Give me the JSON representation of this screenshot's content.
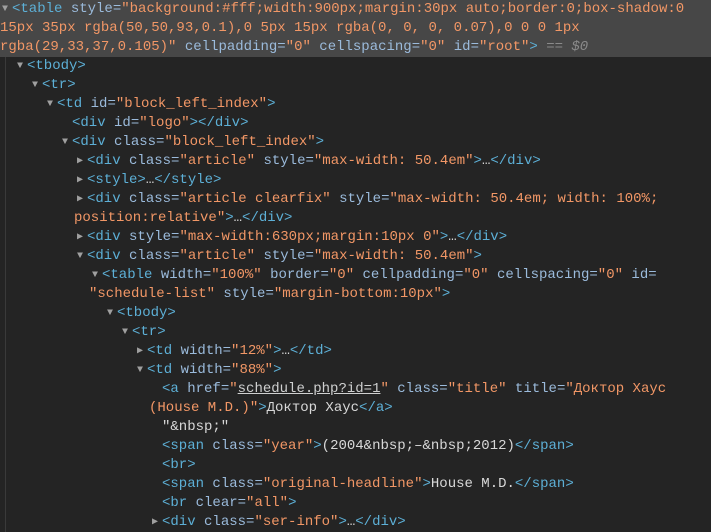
{
  "panel": "Elements",
  "nodes": [
    {
      "level": 0,
      "arrow": "open",
      "selected": true,
      "segs": [
        [
          "t",
          "<table"
        ],
        [
          "n",
          " style"
        ],
        [
          "e",
          "="
        ],
        [
          "v",
          "\"background:#fff;width:900px;margin:30px auto;border:0;box-shadow:0 15px 35px rgba(50,50,93,0.1),0 5px 15px rgba(0, 0, 0, 0.07),0 0 0 1px rgba(29,33,37,0.105)\""
        ],
        [
          "n",
          " cellpadding"
        ],
        [
          "e",
          "="
        ],
        [
          "v",
          "\"0\""
        ],
        [
          "n",
          " cellspacing"
        ],
        [
          "e",
          "="
        ],
        [
          "v",
          "\"0\""
        ],
        [
          "n",
          " id"
        ],
        [
          "e",
          "="
        ],
        [
          "v",
          "\"root\""
        ],
        [
          "t",
          ">"
        ],
        [
          "d",
          " == $0"
        ]
      ]
    },
    {
      "level": 1,
      "arrow": "open",
      "segs": [
        [
          "t",
          "<tbody>"
        ]
      ]
    },
    {
      "level": 2,
      "arrow": "open",
      "segs": [
        [
          "t",
          "<tr>"
        ]
      ]
    },
    {
      "level": 3,
      "arrow": "open",
      "segs": [
        [
          "t",
          "<td"
        ],
        [
          "n",
          " id"
        ],
        [
          "e",
          "="
        ],
        [
          "v",
          "\"block_left_index\""
        ],
        [
          "t",
          ">"
        ]
      ]
    },
    {
      "level": 4,
      "arrow": null,
      "segs": [
        [
          "t",
          "<div"
        ],
        [
          "n",
          " id"
        ],
        [
          "e",
          "="
        ],
        [
          "v",
          "\"logo\""
        ],
        [
          "t",
          "></div>"
        ]
      ]
    },
    {
      "level": 4,
      "arrow": "open",
      "segs": [
        [
          "t",
          "<div"
        ],
        [
          "n",
          " class"
        ],
        [
          "e",
          "="
        ],
        [
          "v",
          "\"block_left_index\""
        ],
        [
          "t",
          ">"
        ]
      ]
    },
    {
      "level": 5,
      "arrow": "closed",
      "segs": [
        [
          "t",
          "<div"
        ],
        [
          "n",
          " class"
        ],
        [
          "e",
          "="
        ],
        [
          "v",
          "\"article\""
        ],
        [
          "n",
          " style"
        ],
        [
          "e",
          "="
        ],
        [
          "v",
          "\"max-width: 50.4em\""
        ],
        [
          "t",
          ">"
        ],
        [
          "x",
          "…"
        ],
        [
          "t",
          "</div>"
        ]
      ]
    },
    {
      "level": 5,
      "arrow": "closed",
      "segs": [
        [
          "t",
          "<style>"
        ],
        [
          "x",
          "…"
        ],
        [
          "t",
          "</style>"
        ]
      ]
    },
    {
      "level": 5,
      "arrow": "closed",
      "segs": [
        [
          "t",
          "<div"
        ],
        [
          "n",
          " class"
        ],
        [
          "e",
          "="
        ],
        [
          "v",
          "\"article clearfix\""
        ],
        [
          "n",
          " style"
        ],
        [
          "e",
          "="
        ],
        [
          "v",
          "\"max-width: 50.4em; width: 100%; position:relative\""
        ],
        [
          "t",
          ">"
        ],
        [
          "x",
          "…"
        ],
        [
          "t",
          "</div>"
        ]
      ]
    },
    {
      "level": 5,
      "arrow": "closed",
      "segs": [
        [
          "t",
          "<div"
        ],
        [
          "n",
          " style"
        ],
        [
          "e",
          "="
        ],
        [
          "v",
          "\"max-width:630px;margin:10px 0\""
        ],
        [
          "t",
          ">"
        ],
        [
          "x",
          "…"
        ],
        [
          "t",
          "</div>"
        ]
      ]
    },
    {
      "level": 5,
      "arrow": "open",
      "segs": [
        [
          "t",
          "<div"
        ],
        [
          "n",
          " class"
        ],
        [
          "e",
          "="
        ],
        [
          "v",
          "\"article\""
        ],
        [
          "n",
          " style"
        ],
        [
          "e",
          "="
        ],
        [
          "v",
          "\"max-width: 50.4em\""
        ],
        [
          "t",
          ">"
        ]
      ]
    },
    {
      "level": 6,
      "arrow": "open",
      "segs": [
        [
          "t",
          "<table"
        ],
        [
          "n",
          " width"
        ],
        [
          "e",
          "="
        ],
        [
          "v",
          "\"100%\""
        ],
        [
          "n",
          " border"
        ],
        [
          "e",
          "="
        ],
        [
          "v",
          "\"0\""
        ],
        [
          "n",
          " cellpadding"
        ],
        [
          "e",
          "="
        ],
        [
          "v",
          "\"0\""
        ],
        [
          "n",
          " cellspacing"
        ],
        [
          "e",
          "="
        ],
        [
          "v",
          "\"0\""
        ],
        [
          "n",
          " id="
        ],
        [
          "v",
          " \"schedule-list\""
        ],
        [
          "n",
          " style"
        ],
        [
          "e",
          "="
        ],
        [
          "v",
          "\"margin-bottom:10px\""
        ],
        [
          "t",
          ">"
        ]
      ]
    },
    {
      "level": 7,
      "arrow": "open",
      "segs": [
        [
          "t",
          "<tbody>"
        ]
      ]
    },
    {
      "level": 8,
      "arrow": "open",
      "segs": [
        [
          "t",
          "<tr>"
        ]
      ]
    },
    {
      "level": 9,
      "arrow": "closed",
      "segs": [
        [
          "t",
          "<td"
        ],
        [
          "n",
          " width"
        ],
        [
          "e",
          "="
        ],
        [
          "v",
          "\"12%\""
        ],
        [
          "t",
          ">"
        ],
        [
          "x",
          "…"
        ],
        [
          "t",
          "</td>"
        ]
      ]
    },
    {
      "level": 9,
      "arrow": "open",
      "segs": [
        [
          "t",
          "<td"
        ],
        [
          "n",
          " width"
        ],
        [
          "e",
          "="
        ],
        [
          "v",
          "\"88%\""
        ],
        [
          "t",
          ">"
        ]
      ]
    },
    {
      "level": 10,
      "arrow": null,
      "segs": [
        [
          "t",
          "<a"
        ],
        [
          "n",
          " href"
        ],
        [
          "e",
          "="
        ],
        [
          "v",
          "\""
        ],
        [
          "l",
          "schedule.php?id=1"
        ],
        [
          "v",
          "\""
        ],
        [
          "n",
          " class"
        ],
        [
          "e",
          "="
        ],
        [
          "v",
          "\"title\""
        ],
        [
          "n",
          " title"
        ],
        [
          "e",
          "="
        ],
        [
          "v",
          "\"Доктор Хаус (House M.D.)\""
        ],
        [
          "t",
          ">"
        ],
        [
          "x",
          "Доктор Хаус"
        ],
        [
          "t",
          "</a>"
        ]
      ]
    },
    {
      "level": 10,
      "arrow": null,
      "segs": [
        [
          "x",
          "\"&nbsp;\""
        ]
      ]
    },
    {
      "level": 10,
      "arrow": null,
      "segs": [
        [
          "t",
          "<span"
        ],
        [
          "n",
          " class"
        ],
        [
          "e",
          "="
        ],
        [
          "v",
          "\"year\""
        ],
        [
          "t",
          ">"
        ],
        [
          "x",
          "(2004&nbsp;–&nbsp;2012)"
        ],
        [
          "t",
          "</span>"
        ]
      ]
    },
    {
      "level": 10,
      "arrow": null,
      "segs": [
        [
          "t",
          "<br>"
        ]
      ]
    },
    {
      "level": 10,
      "arrow": null,
      "segs": [
        [
          "t",
          "<span"
        ],
        [
          "n",
          " class"
        ],
        [
          "e",
          "="
        ],
        [
          "v",
          "\"original-headline\""
        ],
        [
          "t",
          ">"
        ],
        [
          "x",
          "House M.D."
        ],
        [
          "t",
          "</span>"
        ]
      ]
    },
    {
      "level": 10,
      "arrow": null,
      "segs": [
        [
          "t",
          "<br"
        ],
        [
          "n",
          " clear"
        ],
        [
          "e",
          "="
        ],
        [
          "v",
          "\"all\""
        ],
        [
          "t",
          ">"
        ]
      ]
    },
    {
      "level": 10,
      "arrow": "closed",
      "segs": [
        [
          "t",
          "<div"
        ],
        [
          "n",
          " class"
        ],
        [
          "e",
          "="
        ],
        [
          "v",
          "\"ser-info\""
        ],
        [
          "t",
          ">"
        ],
        [
          "x",
          "…"
        ],
        [
          "t",
          "</div>"
        ]
      ]
    }
  ]
}
